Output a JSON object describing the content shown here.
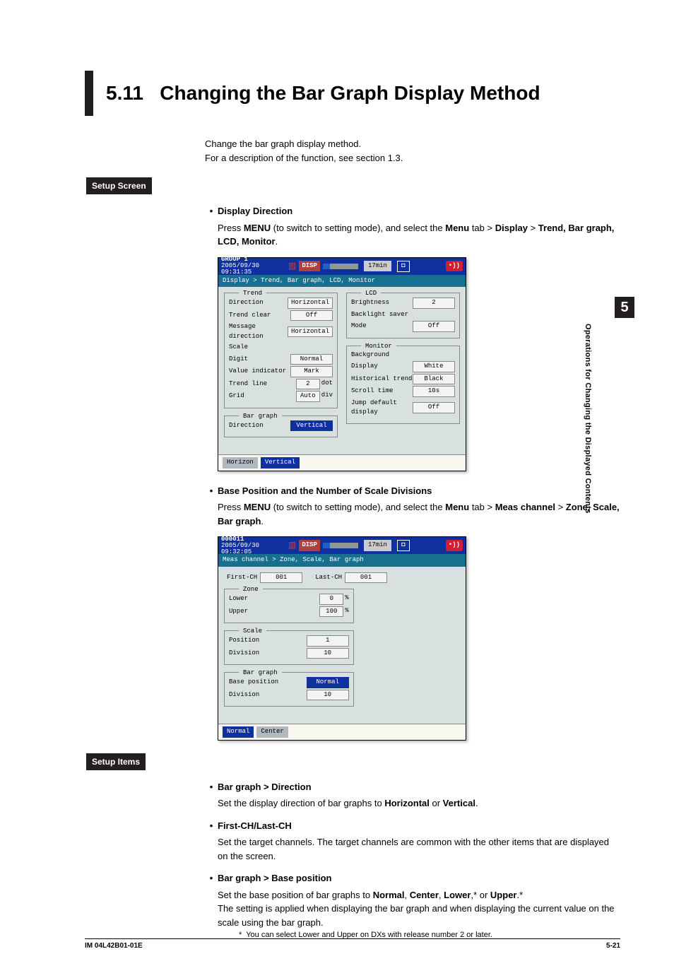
{
  "page": {
    "section_number": "5.11",
    "title": "Changing the Bar Graph Display Method",
    "intro_line1": "Change the bar graph display method.",
    "intro_line2": "For a description of the function, see section 1.3.",
    "setup_screen_label": "Setup Screen",
    "setup_items_label": "Setup Items",
    "tab_number": "5",
    "side_text": "Operations for Changing the Displayed Contents",
    "footer_left": "IM 04L42B01-01E",
    "footer_right": "5-21"
  },
  "bullets": {
    "display_direction": {
      "title": "Display Direction",
      "body_pre": "Press ",
      "body_menu": "MENU",
      "body_mid1": " (to switch to setting mode), and select the ",
      "body_menu2": "Menu",
      "body_mid2": " tab > ",
      "body_display": "Display",
      "body_mid3": " > ",
      "body_trend": "Trend, Bar graph, LCD, Monitor",
      "body_end": "."
    },
    "base_position": {
      "title": "Base Position and the Number of Scale Divisions",
      "body_pre": "Press ",
      "body_menu": "MENU",
      "body_mid1": " (to switch to setting mode), and select the ",
      "body_menu2": "Menu",
      "body_mid2": " tab > ",
      "body_meas": "Meas channel",
      "body_mid3": " > ",
      "body_zone": "Zone, Scale, Bar graph",
      "body_end": "."
    },
    "bg_direction": {
      "title": "Bar graph > Direction",
      "body_a": "Set the display direction of bar graphs to ",
      "body_h": "Horizontal",
      "body_b": " or ",
      "body_v": "Vertical",
      "body_c": "."
    },
    "first_last": {
      "title": "First-CH/Last-CH",
      "body": "Set the target channels. The target channels are common with the other items that are displayed on the screen."
    },
    "bg_basepos": {
      "title": "Bar graph > Base position",
      "body_a": "Set the base position of bar graphs to ",
      "body_normal": "Normal",
      "body_b": ", ",
      "body_center": "Center",
      "body_c": ", ",
      "body_lower": "Lower",
      "body_d": ",* or ",
      "body_upper": "Upper",
      "body_e": ".*",
      "body2": "The setting is applied when displaying the bar graph and when displaying the current value on the scale using the bar graph.",
      "footnote_marker": "*",
      "footnote": "You can select Lower and Upper on DXs with release number 2 or later."
    }
  },
  "screenshot1": {
    "group": "GROUP 1",
    "datetime": "2005/09/30 09:31:35",
    "disp": "DISP",
    "time": "17min",
    "alarm": "•))",
    "breadcrumb": "Display > Trend, Bar graph, LCD, Monitor",
    "trend": {
      "title": "Trend",
      "direction_l": "Direction",
      "direction_v": "Horizontal",
      "trendclear_l": "Trend clear",
      "trendclear_v": "Off",
      "msgdir_l": "Message direction",
      "msgdir_v": "Horizontal",
      "scale_l": "Scale",
      "digit_l": "Digit",
      "digit_v": "Normal",
      "valind_l": "Value indicator",
      "valind_v": "Mark",
      "trendline_l": "Trend line",
      "trendline_v1": "2",
      "trendline_v2": "dot",
      "grid_l": "Grid",
      "grid_v1": "Auto",
      "grid_v2": "div"
    },
    "bargraph": {
      "title": "Bar graph",
      "direction_l": "Direction",
      "direction_v": "Vertical"
    },
    "lcd": {
      "title": "LCD",
      "brightness_l": "Brightness",
      "brightness_v": "2",
      "backlight_l": "Backlight saver",
      "mode_l": "Mode",
      "mode_v": "Off"
    },
    "monitor": {
      "title": "Monitor",
      "background_l": "Background",
      "display_l": "Display",
      "display_v": "White",
      "histtrend_l": "Historical trend",
      "histtrend_v": "Black",
      "scrolltime_l": "Scroll time",
      "scrolltime_v": "10s",
      "jumpdef_l": "Jump default display",
      "jumpdef_v": "Off"
    },
    "softkeys": {
      "k1": "Horizon",
      "k2": "Vertical"
    }
  },
  "screenshot2": {
    "group": "000011",
    "datetime": "2005/09/30 09:32:05",
    "disp": "DISP",
    "time": "17min",
    "alarm": "•))",
    "breadcrumb": "Meas channel > Zone, Scale, Bar graph",
    "first_l": "First-CH",
    "first_v": "001",
    "last_l": "Last-CH",
    "last_v": "001",
    "zone": {
      "title": "Zone",
      "lower_l": "Lower",
      "lower_v": "0",
      "lower_u": "%",
      "upper_l": "Upper",
      "upper_v": "100",
      "upper_u": "%"
    },
    "scale": {
      "title": "Scale",
      "pos_l": "Position",
      "pos_v": "1",
      "div_l": "Division",
      "div_v": "10"
    },
    "bargraph": {
      "title": "Bar graph",
      "bp_l": "Base position",
      "bp_v": "Normal",
      "div_l": "Division",
      "div_v": "10"
    },
    "softkeys": {
      "k1": "Normal",
      "k2": "Center"
    }
  }
}
